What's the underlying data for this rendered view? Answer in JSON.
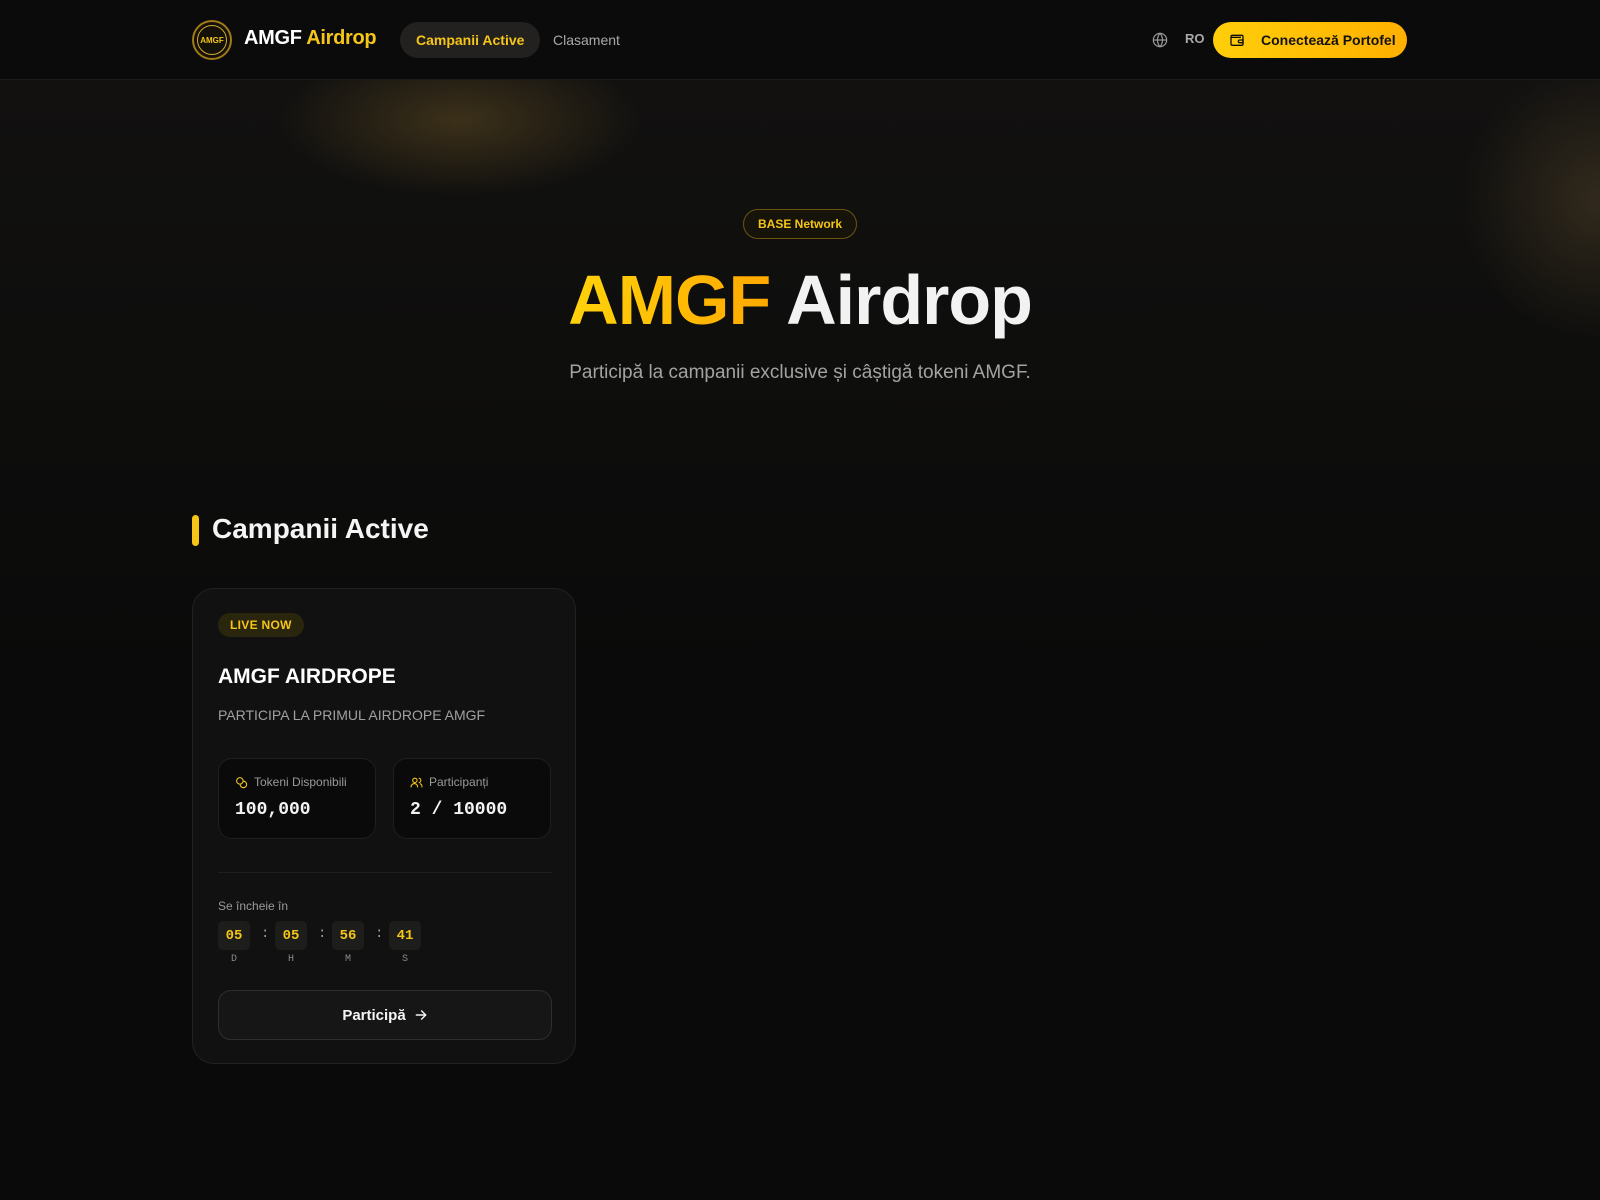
{
  "header": {
    "logo_text": "AMGF",
    "brand_main": "AMGF",
    "brand_accent": "Airdrop",
    "nav": [
      {
        "label": "Campanii Active",
        "active": true
      },
      {
        "label": "Clasament",
        "active": false
      }
    ],
    "language_icon": "globe-icon",
    "language": "RO",
    "connect_icon": "wallet-icon",
    "connect_label": "Conectează Portofel"
  },
  "hero": {
    "network_badge": "BASE Network",
    "title_accent": "AMGF",
    "title_main": "Airdrop",
    "subtitle": "Participă la campanii exclusive și câștigă tokeni AMGF."
  },
  "section": {
    "title": "Campanii Active"
  },
  "campaign": {
    "status": "LIVE NOW",
    "title": "AMGF AIRDROPE",
    "description": "PARTICIPA LA PRIMUL AIRDROPE AMGF",
    "stats": [
      {
        "icon": "coins-icon",
        "label": "Tokeni Disponibili",
        "value": "100,000"
      },
      {
        "icon": "users-icon",
        "label": "Participanți",
        "value": "2 / 10000"
      }
    ],
    "ends_label": "Se încheie în",
    "countdown": [
      {
        "value": "05",
        "unit": "D"
      },
      {
        "value": "05",
        "unit": "H"
      },
      {
        "value": "56",
        "unit": "M"
      },
      {
        "value": "41",
        "unit": "S"
      }
    ],
    "countdown_separator": ":",
    "join_label": "Participă",
    "join_icon": "arrow-right-icon"
  },
  "colors": {
    "accent": "#f5c518",
    "background": "#0a0a0a",
    "card": "#111111"
  }
}
